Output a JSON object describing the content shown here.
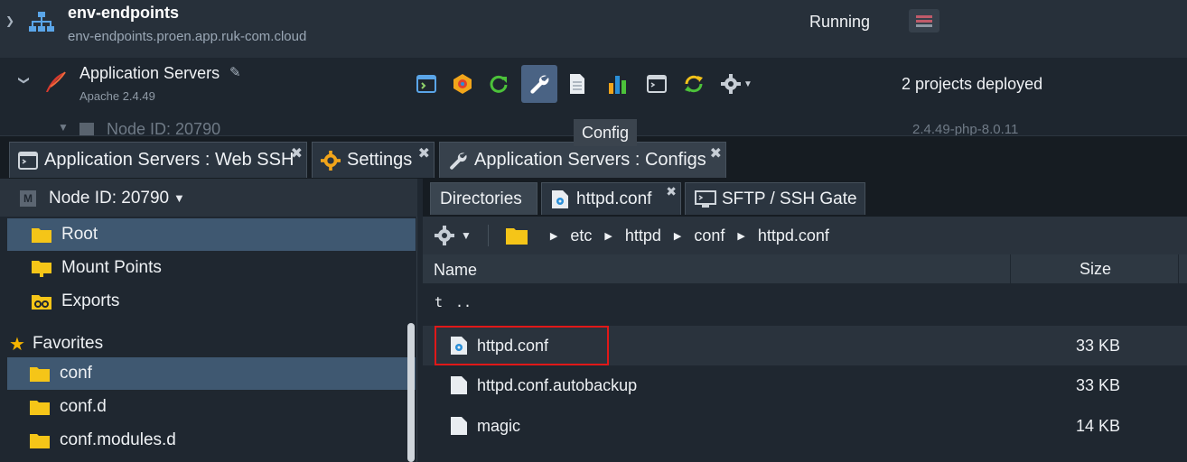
{
  "environment": {
    "name": "env-endpoints",
    "url": "env-endpoints.proen.app.ruk-com.cloud",
    "status": "Running"
  },
  "app_servers": {
    "name": "Application Servers",
    "version": "Apache 2.4.49",
    "projects": "2 projects deployed",
    "toolbar_icons": [
      "web-ssh-icon",
      "addons-icon",
      "restart-icon",
      "config-icon",
      "log-icon",
      "statistics-icon",
      "terminal-icon",
      "redeploy-icon",
      "settings-icon"
    ],
    "tooltip": "Config"
  },
  "node_row": {
    "label": "Node ID: 20790",
    "version": "2.4.49-php-8.0.11"
  },
  "main_tabs": [
    {
      "label": "Application Servers : Web SSH"
    },
    {
      "label": "Settings"
    },
    {
      "label": "Application Servers : Configs"
    }
  ],
  "left_panel": {
    "node_selector": "Node ID: 20790",
    "node_badge": "M",
    "items": [
      {
        "label": "Root"
      },
      {
        "label": "Mount Points"
      },
      {
        "label": "Exports"
      }
    ],
    "favorites_label": "Favorites",
    "favorites": [
      {
        "label": "conf"
      },
      {
        "label": "conf.d"
      },
      {
        "label": "conf.modules.d"
      }
    ]
  },
  "sub_tabs": [
    {
      "label": "Directories"
    },
    {
      "label": "httpd.conf"
    },
    {
      "label": "SFTP / SSH Gate"
    }
  ],
  "path": [
    "etc",
    "httpd",
    "conf",
    "httpd.conf"
  ],
  "grid": {
    "col_name": "Name",
    "col_size": "Size",
    "up_t": "t",
    "up_dots": "..",
    "files": [
      {
        "name": "httpd.conf",
        "size": "33 KB"
      },
      {
        "name": "httpd.conf.autobackup",
        "size": "33 KB"
      },
      {
        "name": "magic",
        "size": "14 KB"
      }
    ]
  },
  "colors": {
    "selected_row": "#3f5871",
    "highlight_border": "#e01818",
    "folder": "#f5c518",
    "accent_active": "#4a6384"
  }
}
